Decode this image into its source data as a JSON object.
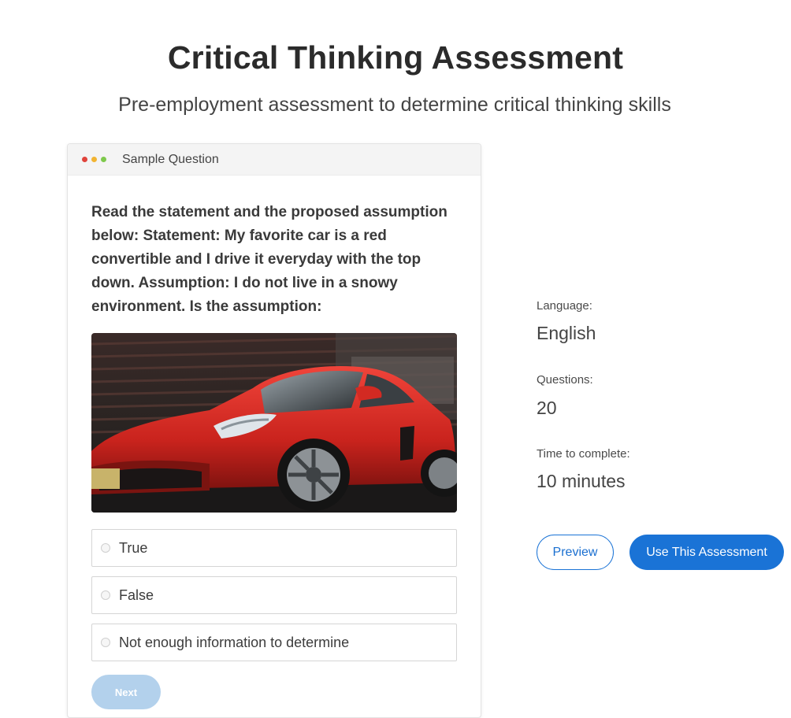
{
  "header": {
    "title": "Critical Thinking Assessment",
    "subtitle": "Pre-employment assessment to determine critical thinking skills"
  },
  "sample_card": {
    "header_label": "Sample Question",
    "window_dots": [
      "#e0433b",
      "#f2b432",
      "#7ec94c"
    ],
    "question": "Read the statement and the proposed assumption below:   Statement: My favorite car is a red convertible and I drive it everyday with the top down. Assumption: I do not live in a snowy environment. Is the assumption:",
    "image_alt": "red sports car",
    "options": [
      {
        "label": "True"
      },
      {
        "label": "False"
      },
      {
        "label": "Not enough information to determine"
      }
    ],
    "next_label": "Next"
  },
  "details": {
    "language_label": "Language:",
    "language_value": "English",
    "questions_label": "Questions:",
    "questions_value": "20",
    "time_label": "Time to complete:",
    "time_value": "10 minutes"
  },
  "actions": {
    "preview_label": "Preview",
    "use_label": "Use This Assessment"
  },
  "colors": {
    "accent": "#1a73d6",
    "disabled_button": "#b3d1ec"
  }
}
